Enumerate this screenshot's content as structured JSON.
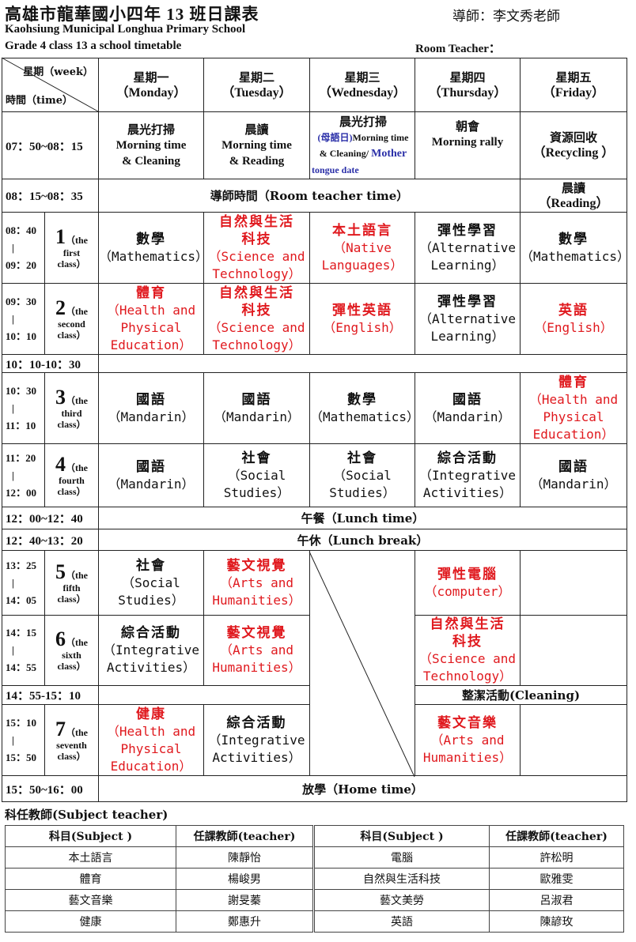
{
  "header": {
    "title_zh": "高雄市龍華國小四年",
    "title_num": " 13 ",
    "title_tail": "班日課表",
    "teacher": "導師：李文秀老師",
    "school_en": "Kaohsiung Municipal Longhua Primary School",
    "timetable_en": "Grade 4 class 13 a school timetable",
    "room_teacher": "Room Teacher："
  },
  "corner": {
    "week": "星期（week）",
    "time": "時間（time）"
  },
  "days": [
    {
      "zh": "星期一",
      "en": "（Monday）"
    },
    {
      "zh": "星期二",
      "en": "（Tuesday）"
    },
    {
      "zh": "星期三",
      "en": "（Wednesday）"
    },
    {
      "zh": "星期四",
      "en": "（Thursday）"
    },
    {
      "zh": "星期五",
      "en": "（Friday）"
    }
  ],
  "morning": {
    "time": "07：50~08：15",
    "mon_zh": "晨光打掃",
    "mon_en1": "Morning time",
    "mon_en2": "& Cleaning",
    "tue_zh": "晨讀",
    "tue_en1": "Morning time",
    "tue_en2": "& Reading",
    "wed_zh": "晨光打掃",
    "wed_a": "(母語日)",
    "wed_b": "Morning time",
    "wed_c": "& Cleaning/",
    "wed_d": "Mother",
    "wed_e": "tongue date",
    "thu_zh": "朝會",
    "thu_en": "Morning rally",
    "fri_zh": "資源回收",
    "fri_en": "（Recycling ）"
  },
  "room_time": {
    "time": "08：15~08：35",
    "label": "導師時間（Room teacher time）",
    "fri_zh": "晨讀",
    "fri_en": "（Reading）"
  },
  "periods": [
    {
      "t1": "08：40",
      "t2": "09：20",
      "num": "1",
      "l1": "（the",
      "l2": "first",
      "l3": "class）"
    },
    {
      "t1": "09：30",
      "t2": "10：10",
      "num": "2",
      "l1": "（the",
      "l2": "second",
      "l3": "class）"
    },
    {
      "t1": "10：30",
      "t2": "11：10",
      "num": "3",
      "l1": "（the",
      "l2": "third",
      "l3": "class）"
    },
    {
      "t1": "11：20",
      "t2": "12：00",
      "num": "4",
      "l1": "（the",
      "l2": "fourth",
      "l3": "class）"
    },
    {
      "t1": "13：25",
      "t2": "14：05",
      "num": "5",
      "l1": "（the",
      "l2": "fifth",
      "l3": "class）"
    },
    {
      "t1": "14：15",
      "t2": "14：55",
      "num": "6",
      "l1": "（the",
      "l2": "sixth",
      "l3": "class）"
    },
    {
      "t1": "15：10",
      "t2": "15：50",
      "num": "7",
      "l1": "（the",
      "l2": "seventh",
      "l3": "class）"
    }
  ],
  "bar": "|",
  "break1": "10：10-10：30",
  "lunch": {
    "time": "12：00~12：40",
    "label": "午餐（Lunch time）"
  },
  "nap": {
    "time": "12：40~13：20",
    "label": "午休（Lunch break）"
  },
  "break2": {
    "time": "14：55-15：10",
    "cleaning": "整潔活動(Cleaning)"
  },
  "home": {
    "time": "15：50~16：00",
    "label": "放學（Home time）"
  },
  "s": {
    "p1_mon_zh": "數學",
    "p1_mon_en": "（Mathematics）",
    "p1_tue_zh1": "自然與生活",
    "p1_tue_zh2": "科技",
    "p1_tue_en1": "（Science and",
    "p1_tue_en2": "Technology）",
    "p1_wed_zh": "本土語言",
    "p1_wed_en1": "（Native",
    "p1_wed_en2": "Languages）",
    "p1_thu_zh": "彈性學習",
    "p1_thu_en1": "（Alternative",
    "p1_thu_en2": "Learning）",
    "p1_fri_zh": "數學",
    "p1_fri_en": "（Mathematics）",
    "p2_mon_zh": "體育",
    "p2_mon_en1": "（Health and",
    "p2_mon_en2": "Physical",
    "p2_mon_en3": "Education）",
    "p2_tue_zh1": "自然與生活",
    "p2_tue_zh2": "科技",
    "p2_tue_en1": "（Science and",
    "p2_tue_en2": "Technology）",
    "p2_wed_zh": "彈性英語",
    "p2_wed_en": "（English）",
    "p2_thu_zh": "彈性學習",
    "p2_thu_en1": "（Alternative",
    "p2_thu_en2": "Learning）",
    "p2_fri_zh": "英語",
    "p2_fri_en": "（English）",
    "p3_mon_zh": "國語",
    "p3_mon_en": "（Mandarin）",
    "p3_tue_zh": "國語",
    "p3_tue_en": "（Mandarin）",
    "p3_wed_zh": "數學",
    "p3_wed_en": "（Mathematics）",
    "p3_thu_zh": "國語",
    "p3_thu_en": "（Mandarin）",
    "p3_fri_zh": "體育",
    "p3_fri_en1": "（Health and",
    "p3_fri_en2": "Physical",
    "p3_fri_en3": "Education）",
    "p4_mon_zh": "國語",
    "p4_mon_en": "（Mandarin）",
    "p4_tue_zh": "社會",
    "p4_tue_en1": "（Social",
    "p4_tue_en2": "Studies）",
    "p4_wed_zh": "社會",
    "p4_wed_en1": "（Social",
    "p4_wed_en2": "Studies）",
    "p4_thu_zh": "綜合活動",
    "p4_thu_en1": "（Integrative",
    "p4_thu_en2": "Activities）",
    "p4_fri_zh": "國語",
    "p4_fri_en": "（Mandarin）",
    "p5_mon_zh": "社會",
    "p5_mon_en1": "（Social",
    "p5_mon_en2": "Studies）",
    "p5_tue_zh": "藝文視覺",
    "p5_tue_en1": "（Arts and",
    "p5_tue_en2": "Humanities）",
    "p5_thu_zh": "彈性電腦",
    "p5_thu_en": "（computer）",
    "p6_mon_zh": "綜合活動",
    "p6_mon_en1": "（Integrative",
    "p6_mon_en2": "Activities）",
    "p6_tue_zh": "藝文視覺",
    "p6_tue_en1": "（Arts and",
    "p6_tue_en2": "Humanities）",
    "p6_thu_zh1": "自然與生活",
    "p6_thu_zh2": "科技",
    "p6_thu_en1": "（Science and",
    "p6_thu_en2": "Technology）",
    "p7_mon_zh": "健康",
    "p7_mon_en1": "（Health and",
    "p7_mon_en2": "Physical",
    "p7_mon_en3": "Education）",
    "p7_tue_zh": "綜合活動",
    "p7_tue_en1": "（Integrative",
    "p7_tue_en2": "Activities）",
    "p7_thu_zh": "藝文音樂",
    "p7_thu_en1": "（Arts and",
    "p7_thu_en2": "Humanities）"
  },
  "subject_teachers": {
    "title": "科任教師(Subject teacher)",
    "h_subject": "科目(Subject )",
    "h_teacher": "任課教師(teacher)",
    "rows": [
      [
        "本土語言",
        "陳靜怡",
        "電腦",
        "許松明"
      ],
      [
        "體育",
        "楊峻男",
        "自然與生活科技",
        "歐雅雯"
      ],
      [
        "藝文音樂",
        "謝旻蓁",
        "藝文美勞",
        "呂淑君"
      ],
      [
        "健康",
        "鄭惠升",
        "英語",
        "陳諺玫"
      ]
    ]
  }
}
